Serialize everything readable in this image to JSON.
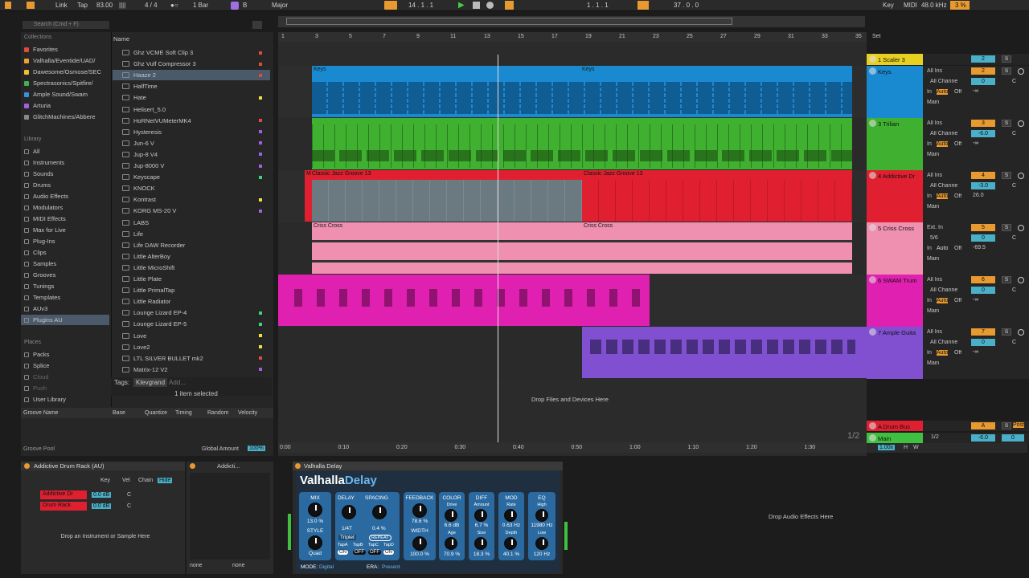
{
  "transport": {
    "link": "Link",
    "tap": "Tap",
    "tempo": "83.00",
    "sig": "4 / 4",
    "quant": "1 Bar",
    "key": "B",
    "scale": "Major",
    "pos": "14 .  1 .  1",
    "loop_start": "1 .  1 .  1",
    "loop_len": "37 .  0 .  0",
    "key_btn": "Key",
    "midi": "MIDI",
    "rate": "48.0 kHz",
    "cpu": "3 %"
  },
  "browser": {
    "search": "Search (Cmd + F)",
    "collections_title": "Collections",
    "collections": [
      {
        "label": "Favorites",
        "color": "#e24a3a"
      },
      {
        "label": "Valhalla/Eventide/UAD/",
        "color": "#f0a030"
      },
      {
        "label": "Dawesome/Osmose/SEC",
        "color": "#f0c030"
      },
      {
        "label": "Spectrasonics/Spitfire/",
        "color": "#40b050"
      },
      {
        "label": "Ample Sound/Swam",
        "color": "#3a90e0"
      },
      {
        "label": "Arturia",
        "color": "#a060e0"
      },
      {
        "label": "GlitchMachines/Abbere",
        "color": "#888888"
      }
    ],
    "library_title": "Library",
    "library": [
      "All",
      "Instruments",
      "Sounds",
      "Drums",
      "Audio Effects",
      "Modulators",
      "MIDI Effects",
      "Max for Live",
      "Plug-Ins",
      "Clips",
      "Samples",
      "Grooves",
      "Tunings",
      "Templates",
      "AUv3",
      "Plugins AU"
    ],
    "places_title": "Places",
    "places": [
      "Packs",
      "Splice",
      "Cloud",
      "Push",
      "User Library"
    ],
    "name_header": "Name",
    "files": [
      {
        "n": "Ghz VCME Soft Clip 3",
        "c": "#e24a3a"
      },
      {
        "n": "Ghz Vulf Compressor 3",
        "c": "#e24a3a"
      },
      {
        "n": "Haaze 2",
        "c": "#e24a3a"
      },
      {
        "n": "HalfTime",
        "c": ""
      },
      {
        "n": "Hate",
        "c": "#f0e040"
      },
      {
        "n": "Helisert_5.0",
        "c": ""
      },
      {
        "n": "HoRNetVUMeterMK4",
        "c": "#e24a3a"
      },
      {
        "n": "Hysteresis",
        "c": "#a060e0"
      },
      {
        "n": "Jun-6 V",
        "c": "#a060e0"
      },
      {
        "n": "Jup-8 V4",
        "c": "#a060e0"
      },
      {
        "n": "Jup-8000 V",
        "c": "#a060e0"
      },
      {
        "n": "Keyscape",
        "c": "#40d080"
      },
      {
        "n": "KNOCK",
        "c": ""
      },
      {
        "n": "Kontrast",
        "c": "#f0e040"
      },
      {
        "n": "KORG MS-20 V",
        "c": "#a060e0"
      },
      {
        "n": "LABS",
        "c": ""
      },
      {
        "n": "Life",
        "c": ""
      },
      {
        "n": "Life DAW Recorder",
        "c": ""
      },
      {
        "n": "Little AlterBoy",
        "c": ""
      },
      {
        "n": "Little MicroShift",
        "c": ""
      },
      {
        "n": "Little Plate",
        "c": ""
      },
      {
        "n": "Little PrimalTap",
        "c": ""
      },
      {
        "n": "Little Radiator",
        "c": ""
      },
      {
        "n": "Lounge Lizard EP-4",
        "c": "#40d080"
      },
      {
        "n": "Lounge Lizard EP-5",
        "c": "#40d080"
      },
      {
        "n": "Love",
        "c": "#f0e040"
      },
      {
        "n": "Love2",
        "c": "#f0e040"
      },
      {
        "n": "LTL SILVER BULLET mk2",
        "c": "#e24a3a"
      },
      {
        "n": "Matrix-12 V2",
        "c": "#a060e0"
      }
    ],
    "tags_label": "Tags:",
    "tag": "Klevgrand",
    "tag_add": "Add...",
    "selected": "1 item selected",
    "groove_cols": [
      "Groove Name",
      "Base",
      "Quantize",
      "Timing",
      "Random",
      "Velocity"
    ],
    "groove_pool": "Groove Pool",
    "global_amount": "Global Amount",
    "global_val": "100%"
  },
  "ruler": {
    "bars": [
      "1",
      "3",
      "5",
      "7",
      "9",
      "11",
      "13",
      "15",
      "17",
      "19",
      "21",
      "23",
      "25",
      "27",
      "29",
      "31",
      "33",
      "35"
    ],
    "times": [
      "0:00",
      "0:10",
      "0:20",
      "0:30",
      "0:40",
      "0:50",
      "1:00",
      "1:10",
      "1:20",
      "1:30"
    ],
    "set": "Set",
    "page": "1/2"
  },
  "tracks": [
    {
      "name": "1 Scaler 3",
      "color": "#e8d020"
    },
    {
      "name": "Keys",
      "color": "#1a8ad0",
      "num": "2"
    },
    {
      "name": "3 Trilian",
      "color": "#40b030",
      "num": "3"
    },
    {
      "name": "4 Addictive Dr",
      "color": "#e02030",
      "num": "4"
    },
    {
      "name": "5 Criss Cross",
      "color": "#f090b0",
      "num": "5"
    },
    {
      "name": "6 SWAM Trum",
      "color": "#e020b0",
      "num": "6"
    },
    {
      "name": "7 Ample Guita",
      "color": "#8050d0",
      "num": "7"
    },
    {
      "name": "A Drum Bus",
      "color": "#e02030",
      "num": "A"
    },
    {
      "name": "Main",
      "color": "#40c040"
    }
  ],
  "clips": {
    "keys": "Keys",
    "groove": "Classic Jazz Groove 13",
    "groove_short": "M",
    "criss": "Criss Cross"
  },
  "drop_here": "Drop Files and Devices Here",
  "mixer": {
    "allins": "All Ins",
    "allch": "All Channe",
    "in": "In",
    "auto": "Auto",
    "off": "Off",
    "main": "Main",
    "inf": "-∞",
    "ext": "Ext. In",
    "sub": "5/6",
    "c": "C",
    "s": "S",
    "vals": [
      "0",
      "-6.0",
      "-3.0",
      "0",
      "0",
      "0"
    ],
    "sends": [
      "",
      "",
      "26.0",
      "-69.5",
      "",
      ""
    ],
    "post": "Post",
    "half": "1/2",
    "main_vol": "-6.0",
    "main_pan": "0",
    "zoom": "1.00x",
    "h": "H",
    "w": "W"
  },
  "drumrack": {
    "title": "Addictive Drum Rack (AU)",
    "key": "Key",
    "vel": "Vel",
    "chain": "Chain",
    "hide": "Hide",
    "chains": [
      {
        "name": "Addictive Dr",
        "vol": "0.0 dB",
        "pan": "C"
      },
      {
        "name": "Drum Rack",
        "vol": "0.0 dB",
        "pan": "C"
      }
    ],
    "drop": "Drop an Instrument or Sample Here",
    "addicti": "Addicti...",
    "none1": "none",
    "none2": "none"
  },
  "valhalla": {
    "title": "Valhalla Delay",
    "brand1": "Valhalla",
    "brand2": "Delay",
    "mix": "MIX",
    "mix_v": "13.0 %",
    "style": "STYLE",
    "style_v": "Quad",
    "delay": "DELAY",
    "delay_v": "1/4T",
    "spacing": "SPACING",
    "spacing_v": "0.4 %",
    "triplet": "Triplet",
    "repeat": "REPEAT",
    "taps": [
      "TapA",
      "TapB",
      "TapC",
      "TapD"
    ],
    "tapv": [
      "ON",
      "OFF",
      "OFF",
      "ON"
    ],
    "feedback": "FEEDBACK",
    "fb_v": "78.6 %",
    "width": "WIDTH",
    "width_v": "100.0 %",
    "color": "COLOR",
    "drive": "Drive",
    "drive_v": "6.6 dB",
    "age": "Age",
    "age_v": "70.9 %",
    "diff": "DIFF",
    "amount": "Amount",
    "amount_v": "6.7 %",
    "size": "Size",
    "size_v": "18.3 %",
    "mod": "MOD",
    "rate": "Rate",
    "rate_v": "0.63 Hz",
    "depth": "Depth",
    "depth_v": "40.1 %",
    "eq": "EQ",
    "high": "High",
    "high_v": "11980 Hz",
    "low": "Low",
    "low_v": "120 Hz",
    "mode_l": "MODE:",
    "mode": "Digital",
    "era_l": "ERA:",
    "era": "Present"
  },
  "drop_audio": "Drop Audio Effects Here"
}
